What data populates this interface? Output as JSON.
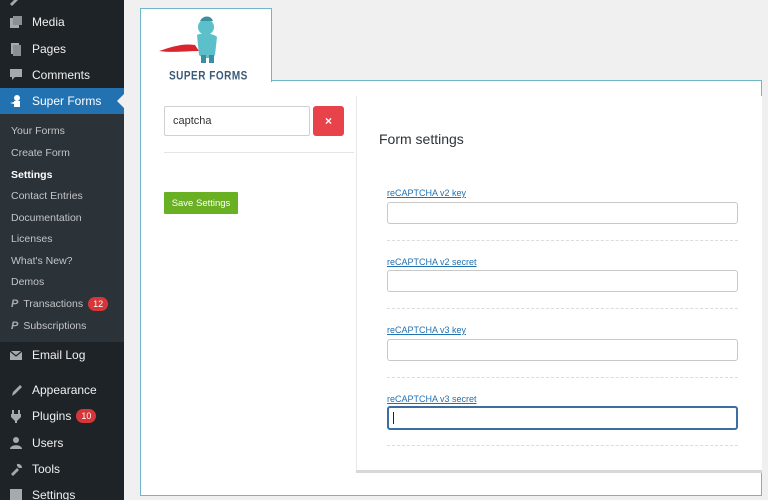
{
  "sidebar": {
    "top_items": [
      {
        "label": "Media",
        "icon": "media-icon"
      },
      {
        "label": "Pages",
        "icon": "pages-icon"
      },
      {
        "label": "Comments",
        "icon": "comments-icon"
      },
      {
        "label": "Super Forms",
        "icon": "super-forms-icon"
      }
    ],
    "submenu": [
      {
        "label": "Your Forms"
      },
      {
        "label": "Create Form"
      },
      {
        "label": "Settings"
      },
      {
        "label": "Contact Entries"
      },
      {
        "label": "Documentation"
      },
      {
        "label": "Licenses"
      },
      {
        "label": "What's New?"
      },
      {
        "label": "Demos"
      },
      {
        "label": "Transactions",
        "badge": "12"
      },
      {
        "label": "Subscriptions"
      }
    ],
    "bottom_items": [
      {
        "label": "Email Log",
        "icon": "email-icon"
      },
      {
        "label": "Appearance",
        "icon": "appearance-icon"
      },
      {
        "label": "Plugins",
        "icon": "plugins-icon",
        "badge": "10"
      },
      {
        "label": "Users",
        "icon": "users-icon"
      },
      {
        "label": "Tools",
        "icon": "tools-icon"
      },
      {
        "label": "Settings",
        "icon": "settings-icon"
      }
    ]
  },
  "logo": {
    "text": "SUPER FORMS"
  },
  "search": {
    "value": "captcha",
    "clear_label": "×"
  },
  "save_label": "Save Settings",
  "settings": {
    "title": "Form settings",
    "fields": [
      {
        "label": "reCAPTCHA v2 key",
        "value": ""
      },
      {
        "label": "reCAPTCHA v2 secret",
        "value": ""
      },
      {
        "label": "reCAPTCHA v3 key",
        "value": ""
      },
      {
        "label": "reCAPTCHA v3 secret",
        "value": ""
      }
    ]
  },
  "colors": {
    "sidebar": "#1d2327",
    "active": "#2271b1",
    "clear": "#e8434a",
    "save": "#6ab023"
  }
}
